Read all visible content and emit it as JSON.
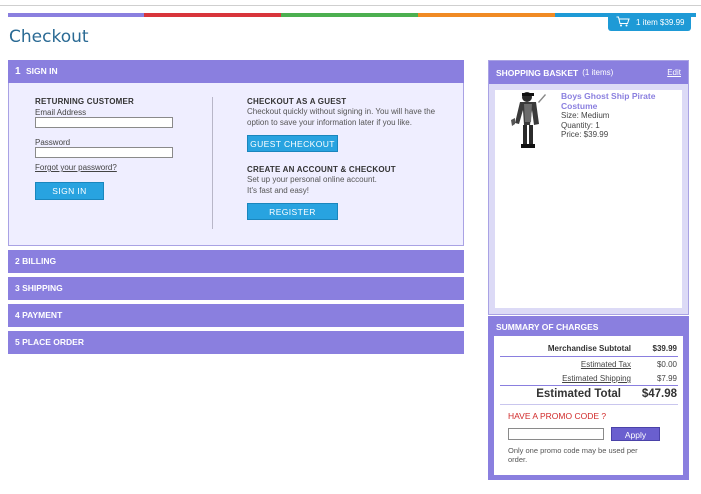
{
  "colors": {
    "strip": [
      "#8a7fdf",
      "#d8353b",
      "#4caf50",
      "#f08a24",
      "#1e9ad6"
    ],
    "accent": "#8a7fdf",
    "cart_badge": "#1e9ad6",
    "button_blue": "#28a3e0",
    "promo_red": "#d12a2a"
  },
  "cart_badge": {
    "icon": "cart-icon",
    "label": "1 item $39.99"
  },
  "page_title": "Checkout",
  "steps": {
    "sign_in": {
      "number": "1",
      "label": "SIGN IN",
      "returning": {
        "heading": "RETURNING CUSTOMER",
        "email_label": "Email Address",
        "email_value": "",
        "password_label": "Password",
        "password_value": "",
        "forgot_link": "Forgot your password?",
        "sign_in_button": "SIGN IN"
      },
      "guest": {
        "heading": "CHECKOUT AS A GUEST",
        "text_1": "Checkout quickly without signing in. You will have the",
        "text_2": "option to save your information later if you like.",
        "button": "GUEST CHECKOUT"
      },
      "account": {
        "heading": "CREATE AN ACCOUNT & CHECKOUT",
        "text_1": "Set up your personal online account.",
        "text_2": "It's fast and easy!",
        "button": "REGISTER"
      }
    },
    "others": [
      {
        "number": "2",
        "label": "BILLING"
      },
      {
        "number": "3",
        "label": "SHIPPING"
      },
      {
        "number": "4",
        "label": "PAYMENT"
      },
      {
        "number": "5",
        "label": "PLACE ORDER"
      }
    ]
  },
  "basket": {
    "title": "SHOPPING BASKET",
    "count": "(1 items)",
    "edit": "Edit",
    "item": {
      "name": "Boys Ghost Ship Pirate Costume",
      "size": "Size: Medium",
      "quantity": "Quantity:  1",
      "price": "Price: $39.99"
    }
  },
  "summary": {
    "title": "SUMMARY OF CHARGES",
    "merch_label": "Merchandise Subtotal",
    "merch_value": "$39.99",
    "tax_label": "Estimated Tax",
    "tax_value": "$0.00",
    "ship_label": "Estimated Shipping",
    "ship_value": "$7.99",
    "total_label": "Estimated Total",
    "total_value": "$47.98",
    "promo_title": "HAVE A PROMO CODE ?",
    "promo_value": "",
    "apply": "Apply",
    "promo_note": "Only one promo code may be used per order."
  }
}
